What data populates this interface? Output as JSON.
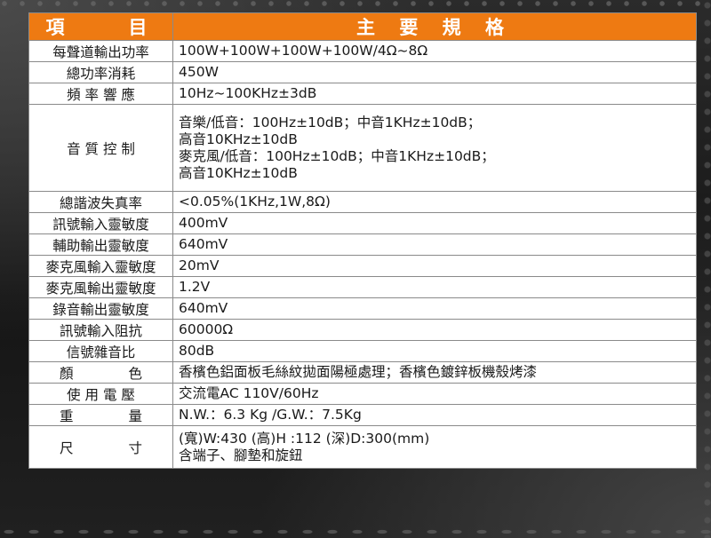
{
  "header": {
    "item_label": "項　　目",
    "spec_label": "主 要 規 格"
  },
  "rows": [
    {
      "label": "每聲道輸出功率",
      "value": [
        "100W+100W+100W+100W/4Ω~8Ω"
      ]
    },
    {
      "label": "總功率消耗",
      "value": [
        "450W"
      ]
    },
    {
      "label": "頻 率 響 應",
      "value": [
        "10Hz~100KHz±3dB"
      ]
    },
    {
      "label": "音 質 控 制",
      "value": [
        "音樂/低音：100Hz±10dB；中音1KHz±10dB；",
        "高音10KHz±10dB",
        "麥克風/低音：100Hz±10dB；中音1KHz±10dB；",
        "高音10KHz±10dB"
      ]
    },
    {
      "label": "總諧波失真率",
      "value": [
        "<0.05%(1KHz,1W,8Ω)"
      ]
    },
    {
      "label": "訊號輸入靈敏度",
      "value": [
        "400mV"
      ]
    },
    {
      "label": "輔助輸出靈敏度",
      "value": [
        "640mV"
      ]
    },
    {
      "label": "麥克風輸入靈敏度",
      "value": [
        "20mV"
      ]
    },
    {
      "label": "麥克風輸出靈敏度",
      "value": [
        "1.2V"
      ]
    },
    {
      "label": "錄音輸出靈敏度",
      "value": [
        "640mV"
      ]
    },
    {
      "label": "訊號輸入阻抗",
      "value": [
        "60000Ω"
      ]
    },
    {
      "label": "信號雜音比",
      "value": [
        "80dB"
      ]
    },
    {
      "label": "顏　　　　色",
      "value": [
        "香檳色鋁面板毛絲紋拋面陽極處理；香檳色鍍鋅板機殼烤漆"
      ]
    },
    {
      "label": "使 用 電 壓",
      "value": [
        "交流電AC 110V/60Hz"
      ]
    },
    {
      "label": "重　　　　量",
      "value": [
        "N.W.：6.3 Kg /G.W.：7.5Kg"
      ]
    },
    {
      "label": "尺　　　　寸",
      "value": [
        "(寬)W:430 (高)H :112 (深)D:300(mm)",
        "含端子、腳墊和旋鈕"
      ]
    }
  ],
  "colors": {
    "header_bg": "#ee7a12",
    "header_text": "#ffffff",
    "cell_bg": "#ffffff",
    "border": "#8a8a8a",
    "page_bg": "#1a1a1a"
  }
}
